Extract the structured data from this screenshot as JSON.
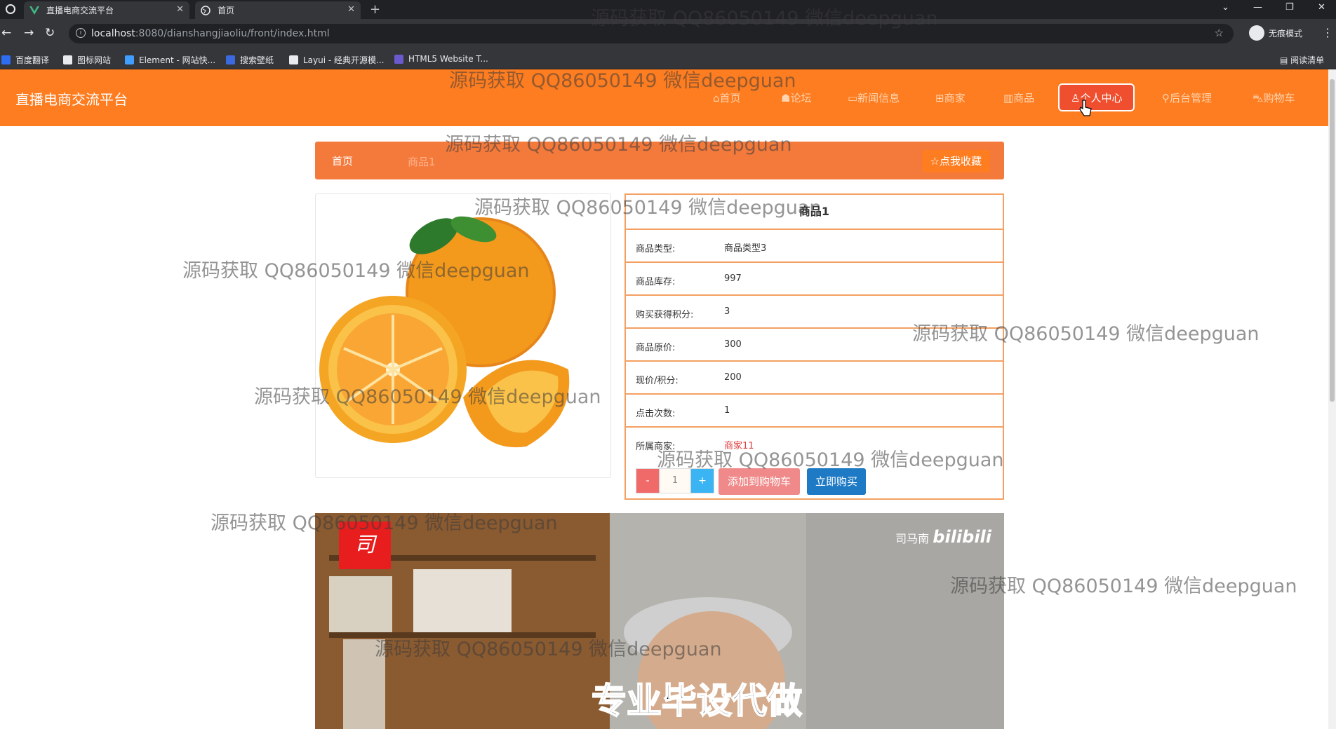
{
  "browser": {
    "tabs": [
      {
        "title": "直播电商交流平台"
      },
      {
        "title": "首页"
      }
    ],
    "new_tab": "+",
    "url_host": "localhost",
    "url_rest": ":8080/dianshangjiaoliu/front/index.html",
    "incognito_label": "无痕模式",
    "reading_list": "阅读清单",
    "bookmarks": [
      {
        "label": "百度翻译",
        "color": "#2f6df0"
      },
      {
        "label": "图标网站",
        "color": "#e8eaed"
      },
      {
        "label": "Element - 网站快...",
        "color": "#409eff"
      },
      {
        "label": "搜索壁纸",
        "color": "#3b6ae0"
      },
      {
        "label": "Layui - 经典开源模...",
        "color": "#e8eaed"
      },
      {
        "label": "HTML5 Website T...",
        "color": "#6a5acd"
      }
    ]
  },
  "site": {
    "title": "直播电商交流平台",
    "nav": [
      {
        "label": "⌂首页"
      },
      {
        "label": "☗论坛"
      },
      {
        "label": "▭新闻信息"
      },
      {
        "label": "⊞商家"
      },
      {
        "label": "▥商品"
      },
      {
        "label": "♙个人中心"
      },
      {
        "label": "⚲后台管理"
      },
      {
        "label": "⛍购物车"
      }
    ],
    "accent": "#fe7d20"
  },
  "breadcrumb": {
    "home": "首页",
    "current": "商品1",
    "favorite": "☆点我收藏"
  },
  "product": {
    "title": "商品1",
    "rows": [
      {
        "label": "商品类型:",
        "value": "商品类型3"
      },
      {
        "label": "商品库存:",
        "value": "997"
      },
      {
        "label": "购买获得积分:",
        "value": "3"
      },
      {
        "label": "商品原价:",
        "value": "300"
      },
      {
        "label": "现价/积分:",
        "value": "200"
      },
      {
        "label": "点击次数:",
        "value": "1"
      },
      {
        "label": "所属商家:",
        "value": "商家11"
      }
    ],
    "qty_minus": "-",
    "qty_value": "1",
    "qty_plus": "+",
    "add_to_cart": "添加到购物车",
    "buy_now": "立即购买"
  },
  "video": {
    "logo": "司",
    "channel": "司马南",
    "platform": "bilibili",
    "caption": "专业毕设代做"
  },
  "watermark": "源码获取 QQ86050149 微信deepguan"
}
